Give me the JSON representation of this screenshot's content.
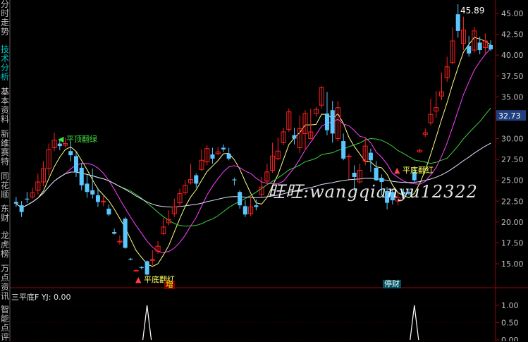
{
  "sidebar": {
    "tabs": [
      {
        "label": "分时走势",
        "active": false
      },
      {
        "label": "技术分析",
        "active": true
      },
      {
        "label": "基本资料",
        "active": false
      },
      {
        "label": "新维赛特",
        "active": false
      },
      {
        "label": "同花顺",
        "active": false
      },
      {
        "label": "东财",
        "active": false
      },
      {
        "label": "龙虎榜",
        "active": false
      },
      {
        "label": "万点资讯",
        "active": false
      },
      {
        "label": "智能点评",
        "active": false
      }
    ]
  },
  "main_chart": {
    "peak_label": "45.89",
    "watermark": "旺旺:wangqianyu12322",
    "signal_top_green": "平顶翻绿",
    "signal_bottom_red_1": "平底翻红",
    "signal_bottom_red_2": "平底翻红",
    "badge_zeng": "增",
    "badge_tingcai": "停财",
    "colors": {
      "up": "#ff2020",
      "down": "#5ac8ff",
      "ma5": "#ffff80",
      "ma10": "#ff40ff",
      "ma20": "#40d040",
      "ma60": "#e0e0ff"
    }
  },
  "indicator": {
    "title": "三平底F  YJ: 0.00"
  },
  "chart_data": [
    {
      "type": "candlestick",
      "yaxis": {
        "ticks": [
          "45.00",
          "42.50",
          "40.00",
          "37.50",
          "35.00",
          "32.50",
          "30.00",
          "27.50",
          "25.00",
          "22.50",
          "20.00",
          "17.50",
          "15.00"
        ],
        "ylim": [
          12.8,
          46.2
        ]
      },
      "last_price_label": "32.73",
      "candles": [
        [
          22.4,
          22.2,
          23.0,
          21.8
        ],
        [
          22.0,
          21.2,
          22.5,
          20.6
        ],
        [
          22.8,
          22.7,
          23.6,
          22.3
        ],
        [
          23.0,
          23.5,
          24.1,
          22.8
        ],
        [
          23.8,
          24.8,
          25.8,
          23.3
        ],
        [
          24.8,
          26.4,
          27.3,
          24.3
        ],
        [
          26.4,
          28.7,
          29.4,
          25.6
        ],
        [
          28.9,
          29.8,
          30.7,
          28.5
        ],
        [
          29.4,
          29.1,
          30.0,
          28.6
        ],
        [
          29.2,
          29.4,
          30.1,
          28.9
        ],
        [
          28.5,
          28.0,
          29.6,
          27.3
        ],
        [
          27.9,
          26.0,
          28.4,
          25.4
        ],
        [
          26.5,
          24.4,
          27.1,
          23.8
        ],
        [
          24.6,
          23.6,
          25.6,
          22.9
        ],
        [
          23.8,
          23.3,
          26.4,
          22.8
        ],
        [
          23.2,
          22.4,
          24.1,
          21.8
        ],
        [
          22.5,
          22.5,
          23.1,
          21.9
        ],
        [
          21.6,
          20.9,
          22.1,
          20.7
        ],
        [
          18.8,
          18.6,
          19.2,
          18.5
        ],
        [
          17.6,
          17.7,
          18.4,
          17.3
        ],
        [
          20.4,
          16.9,
          20.6,
          16.8
        ],
        [
          15.6,
          15.5,
          15.7,
          15.4
        ],
        [
          14.2,
          14.2,
          14.3,
          14.1
        ],
        [
          14.6,
          14.5,
          14.7,
          14.3
        ],
        [
          15.3,
          13.7,
          15.4,
          13.6
        ],
        [
          15.4,
          15.5,
          16.6,
          14.8
        ],
        [
          16.5,
          17.1,
          17.7,
          16.2
        ],
        [
          18.6,
          19.4,
          20.5,
          18.4
        ],
        [
          19.9,
          20.3,
          21.4,
          19.6
        ],
        [
          21.0,
          21.8,
          22.8,
          20.6
        ],
        [
          22.3,
          23.4,
          24.0,
          21.8
        ],
        [
          23.5,
          24.4,
          25.0,
          23.2
        ],
        [
          24.7,
          25.1,
          27.0,
          24.5
        ],
        [
          25.6,
          24.6,
          25.8,
          24.1
        ],
        [
          26.3,
          27.4,
          28.7,
          26.1
        ],
        [
          27.2,
          28.8,
          29.2,
          26.8
        ],
        [
          28.1,
          27.6,
          28.9,
          27.0
        ],
        [
          28.2,
          28.4,
          29.0,
          28.0
        ],
        [
          28.9,
          28.7,
          29.3,
          28.4
        ],
        [
          28.2,
          27.6,
          28.9,
          27.4
        ],
        [
          25.1,
          25.0,
          25.3,
          24.4
        ],
        [
          23.6,
          22.0,
          23.8,
          21.6
        ],
        [
          21.9,
          20.9,
          22.6,
          20.6
        ],
        [
          21.0,
          21.8,
          23.1,
          20.7
        ],
        [
          22.0,
          21.8,
          22.7,
          21.4
        ],
        [
          23.3,
          24.2,
          25.4,
          23.0
        ],
        [
          24.9,
          26.0,
          27.0,
          24.4
        ],
        [
          26.2,
          27.9,
          29.5,
          25.9
        ],
        [
          27.6,
          28.5,
          30.1,
          27.4
        ],
        [
          29.5,
          30.8,
          31.3,
          29.2
        ],
        [
          31.1,
          33.2,
          33.6,
          30.8
        ],
        [
          30.4,
          30.0,
          31.3,
          29.3
        ],
        [
          28.9,
          31.2,
          32.8,
          28.3
        ],
        [
          30.6,
          33.0,
          33.4,
          28.6
        ],
        [
          30.0,
          30.8,
          33.6,
          29.9
        ],
        [
          33.0,
          33.5,
          33.8,
          32.6
        ],
        [
          34.0,
          36.1,
          36.3,
          33.6
        ],
        [
          33.0,
          31.0,
          35.6,
          30.4
        ],
        [
          33.4,
          30.6,
          34.5,
          29.5
        ],
        [
          30.0,
          33.7,
          34.5,
          29.7
        ],
        [
          29.7,
          27.6,
          30.6,
          27.4
        ],
        [
          27.8,
          27.9,
          28.2,
          25.1
        ],
        [
          25.9,
          25.4,
          26.8,
          23.7
        ],
        [
          24.8,
          26.2,
          27.0,
          24.6
        ],
        [
          27.3,
          29.1,
          30.0,
          26.8
        ],
        [
          28.3,
          27.4,
          28.8,
          26.0
        ],
        [
          26.5,
          25.0,
          27.3,
          24.9
        ],
        [
          25.3,
          24.8,
          25.7,
          23.2
        ],
        [
          23.7,
          22.3,
          24.2,
          21.5
        ],
        [
          23.6,
          22.6,
          24.0,
          22.1
        ],
        [
          22.5,
          22.9,
          23.5,
          22.0
        ],
        [
          23.6,
          23.3,
          24.0,
          23.0
        ],
        [
          23.6,
          23.4,
          24.0,
          23.2
        ],
        [
          26.0,
          25.0,
          26.6,
          24.8
        ],
        [
          28.4,
          28.6,
          28.8,
          28.3
        ],
        [
          30.5,
          30.7,
          31.2,
          30.2
        ],
        [
          31.9,
          32.9,
          34.8,
          31.6
        ],
        [
          33.3,
          33.7,
          35.7,
          32.5
        ],
        [
          35.1,
          35.6,
          37.9,
          34.6
        ],
        [
          37.3,
          38.6,
          39.8,
          36.8
        ],
        [
          39.1,
          41.7,
          43.3,
          38.9
        ],
        [
          44.9,
          42.9,
          46.1,
          42.1
        ],
        [
          41.4,
          43.0,
          44.6,
          40.6
        ],
        [
          41.1,
          40.2,
          42.3,
          39.8
        ],
        [
          40.6,
          42.9,
          43.4,
          40.3
        ],
        [
          41.5,
          40.6,
          42.2,
          40.1
        ],
        [
          40.9,
          41.7,
          42.6,
          40.2
        ],
        [
          41.2,
          40.7,
          41.8,
          40.5
        ]
      ]
    },
    {
      "type": "line",
      "yaxis": {
        "ticks": [
          "1.00",
          "0.50",
          "0.00"
        ],
        "ylim": [
          0,
          1.2
        ]
      },
      "values_nonzero": [
        {
          "index": 24,
          "value": 1
        },
        {
          "index": 73,
          "value": 1
        }
      ]
    }
  ]
}
